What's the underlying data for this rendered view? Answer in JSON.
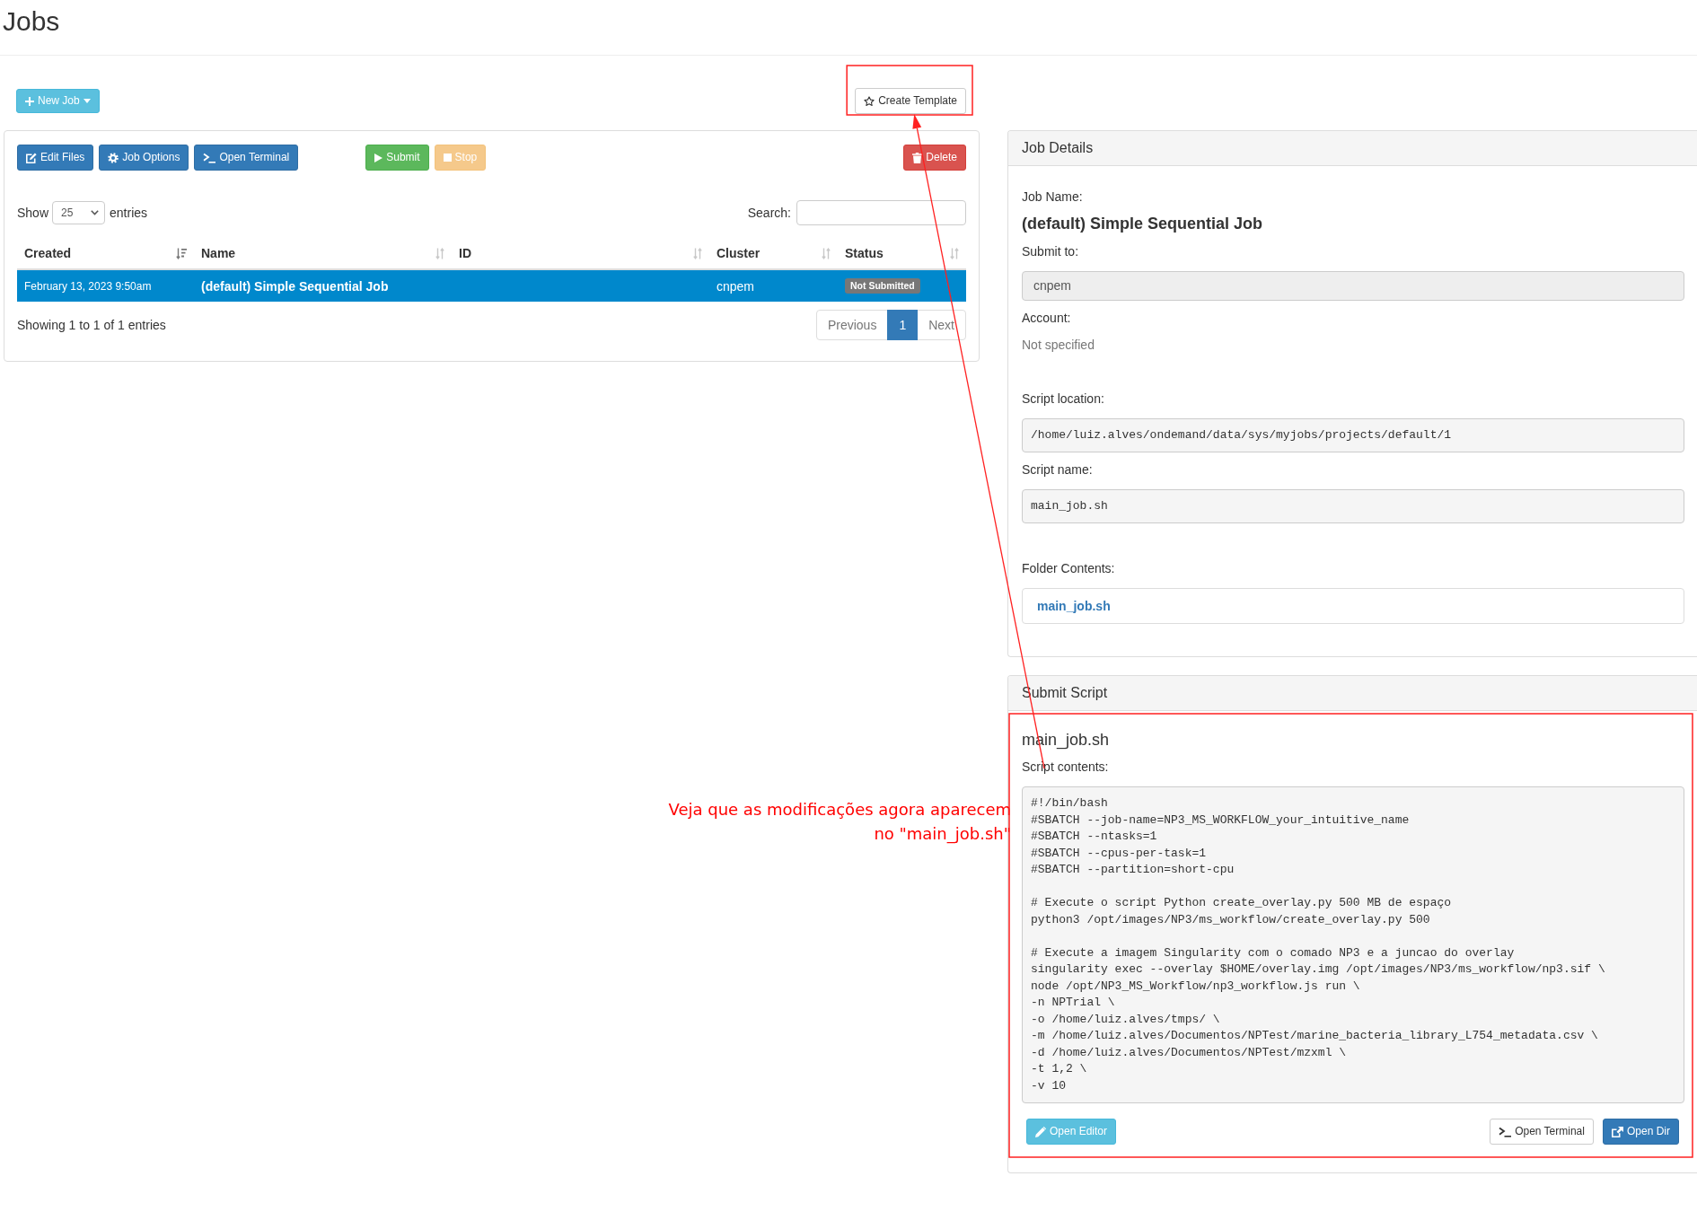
{
  "page": {
    "title": "Jobs"
  },
  "toolbar": {
    "new_job": {
      "label": "New Job"
    },
    "create_template": {
      "label": "Create Template"
    }
  },
  "jobs_panel": {
    "actions": [
      {
        "kind": "edit",
        "label": "Edit Files",
        "disabled": false
      },
      {
        "kind": "options",
        "label": "Job Options",
        "disabled": false
      },
      {
        "kind": "terminal",
        "label": "Open Terminal",
        "disabled": false
      },
      {
        "kind": "submit",
        "label": "Submit",
        "disabled": false
      },
      {
        "kind": "stop",
        "label": "Stop",
        "disabled": true
      },
      {
        "kind": "delete",
        "label": "Delete",
        "disabled": false
      }
    ],
    "length_menu": {
      "label_before": "Show",
      "value": "25",
      "label_after": "entries"
    },
    "search": {
      "label": "Search:"
    },
    "table": {
      "columns": [
        {
          "label": "Created",
          "sorted": true
        },
        {
          "label": "Name",
          "sorted": false
        },
        {
          "label": "ID",
          "sorted": false
        },
        {
          "label": "Cluster",
          "sorted": false
        },
        {
          "label": "Status",
          "sorted": false
        }
      ],
      "rows": [
        {
          "selected": true,
          "created": "February 13, 2023 9:50am",
          "name": "(default) Simple Sequential Job",
          "cluster": "cnpem",
          "status": "Not Submitted"
        }
      ]
    },
    "info": "Showing 1 to 1 of 1 entries",
    "pagination": {
      "previous": {
        "label": "Previous",
        "disabled": true
      },
      "pages": [
        {
          "label": "1",
          "selected": true
        }
      ],
      "next": {
        "label": "Next",
        "disabled": true
      }
    }
  },
  "job_details": {
    "title": "Job Details",
    "sections": [
      {
        "fields": [
          {
            "kind": "title",
            "label": "Job Name:",
            "value": "(default) Simple Sequential Job"
          },
          {
            "kind": "select",
            "label": "Submit to:",
            "value": "cnpem",
            "disabled": true
          },
          {
            "kind": "muted",
            "label": "Account:",
            "value": "Not specified"
          }
        ]
      },
      {
        "fields": [
          {
            "kind": "code",
            "label": "Script location:",
            "value": "/home/luiz.alves/ondemand/data/sys/myjobs/projects/default/1"
          },
          {
            "kind": "code",
            "label": "Script name:",
            "value": "main_job.sh"
          }
        ]
      },
      {
        "fields": [
          {
            "kind": "files",
            "label": "Folder Contents:",
            "files": [
              "main_job.sh"
            ]
          }
        ]
      }
    ]
  },
  "submit_script": {
    "title": "Submit Script",
    "file_name": "main_job.sh",
    "contents_label": "Script contents:",
    "script": "#!/bin/bash\n#SBATCH --job-name=NP3_MS_WORKFLOW_your_intuitive_name\n#SBATCH --ntasks=1\n#SBATCH --cpus-per-task=1\n#SBATCH --partition=short-cpu\n\n# Execute o script Python create_overlay.py 500 MB de espaço\npython3 /opt/images/NP3/ms_workflow/create_overlay.py 500\n\n# Execute a imagem Singularity com o comado NP3 e a juncao do overlay\nsingularity exec --overlay $HOME/overlay.img /opt/images/NP3/ms_workflow/np3.sif \\\nnode /opt/NP3_MS_Workflow/np3_workflow.js run \\\n-n NPTrial \\\n-o /home/luiz.alves/tmps/ \\\n-m /home/luiz.alves/Documentos/NPTest/marine_bacteria_library_L754_metadata.csv \\\n-d /home/luiz.alves/Documentos/NPTest/mzxml \\\n-t 1,2 \\\n-v 10",
    "buttons": [
      {
        "kind": "editor",
        "label": "Open Editor"
      },
      {
        "kind": "terminal",
        "label": "Open Terminal"
      },
      {
        "kind": "dir",
        "label": "Open Dir"
      }
    ]
  },
  "annotation": {
    "text": "Veja que as modificações agora aparecem\nno \"main_job.sh\""
  }
}
